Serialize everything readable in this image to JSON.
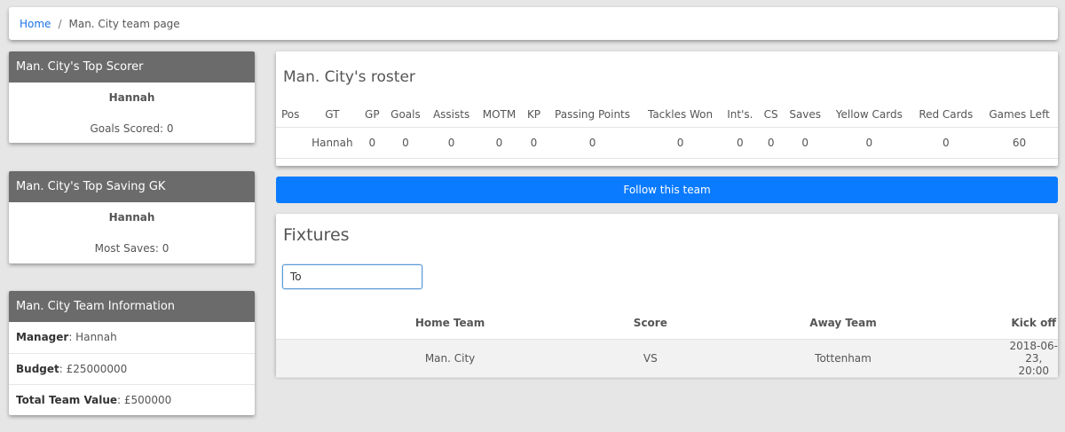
{
  "breadcrumb": {
    "home": "Home",
    "separator": "/",
    "current": "Man. City team page"
  },
  "top_scorer": {
    "title": "Man. City's Top Scorer",
    "name": "Hannah",
    "stat": "Goals Scored: 0"
  },
  "top_gk": {
    "title": "Man. City's Top Saving GK",
    "name": "Hannah",
    "stat": "Most Saves: 0"
  },
  "team_info": {
    "title": "Man. City Team Information",
    "rows": [
      {
        "label": "Manager",
        "value": ": Hannah"
      },
      {
        "label": "Budget",
        "value": ": £25000000"
      },
      {
        "label": "Total Team Value",
        "value": ": £500000"
      }
    ]
  },
  "roster": {
    "title": "Man. City's roster",
    "headers": [
      "Pos",
      "GT",
      "GP",
      "Goals",
      "Assists",
      "MOTM",
      "KP",
      "Passing Points",
      "Tackles Won",
      "Int's.",
      "CS",
      "Saves",
      "Yellow Cards",
      "Red Cards",
      "Games Left"
    ],
    "rows": [
      [
        "",
        "Hannah",
        "0",
        "0",
        "0",
        "0",
        "0",
        "0",
        "0",
        "0",
        "0",
        "0",
        "0",
        "0",
        "60"
      ]
    ]
  },
  "follow_button": "Follow this team",
  "fixtures": {
    "title": "Fixtures",
    "search_value": "To",
    "headers": [
      "Home Team",
      "Score",
      "Away Team",
      "Kick off"
    ],
    "rows": [
      [
        "Man. City",
        "VS",
        "Tottenham",
        "2018-06-23, 20:00"
      ]
    ]
  },
  "colors": {
    "header_gray": "#6b6b6b",
    "button_blue": "#0a7bff",
    "link_blue": "#1a73e8"
  }
}
